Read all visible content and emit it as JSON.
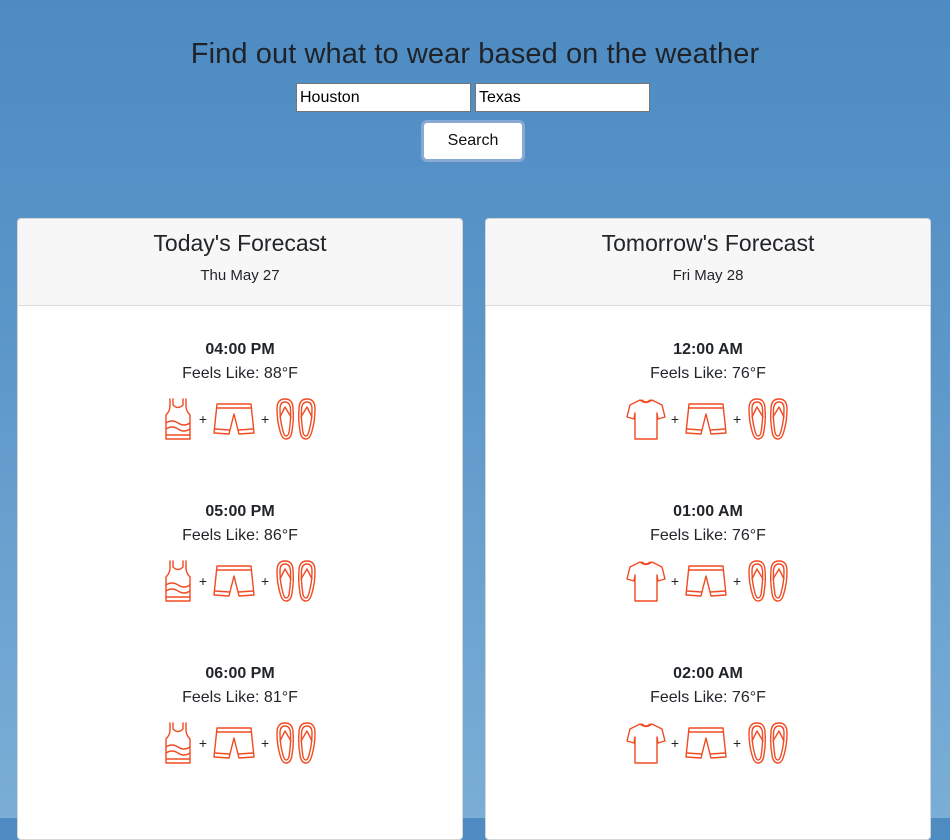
{
  "header": {
    "title": "Find out what to wear based on the weather",
    "city_value": "Houston",
    "state_value": "Texas",
    "search_label": "Search"
  },
  "colors": {
    "icon_stroke": "#f04b22",
    "background": "#5b96c9"
  },
  "today": {
    "title": "Today's Forecast",
    "date": "Thu May 27",
    "slots": [
      {
        "time": "04:00 PM",
        "feels": "Feels Like: 88°F",
        "plus1": "+",
        "plus2": "+",
        "icons": [
          "tank-top-icon",
          "shorts-icon",
          "flip-flops-icon"
        ]
      },
      {
        "time": "05:00 PM",
        "feels": "Feels Like: 86°F",
        "plus1": "+",
        "plus2": "+",
        "icons": [
          "tank-top-icon",
          "shorts-icon",
          "flip-flops-icon"
        ]
      },
      {
        "time": "06:00 PM",
        "feels": "Feels Like: 81°F",
        "plus1": "+",
        "plus2": "+",
        "icons": [
          "tank-top-icon",
          "shorts-icon",
          "flip-flops-icon"
        ]
      }
    ]
  },
  "tomorrow": {
    "title": "Tomorrow's Forecast",
    "date": "Fri May 28",
    "slots": [
      {
        "time": "12:00 AM",
        "feels": "Feels Like: 76°F",
        "plus1": "+",
        "plus2": "+",
        "icons": [
          "t-shirt-icon",
          "shorts-icon",
          "flip-flops-icon"
        ]
      },
      {
        "time": "01:00 AM",
        "feels": "Feels Like: 76°F",
        "plus1": "+",
        "plus2": "+",
        "icons": [
          "t-shirt-icon",
          "shorts-icon",
          "flip-flops-icon"
        ]
      },
      {
        "time": "02:00 AM",
        "feels": "Feels Like: 76°F",
        "plus1": "+",
        "plus2": "+",
        "icons": [
          "t-shirt-icon",
          "shorts-icon",
          "flip-flops-icon"
        ]
      }
    ]
  }
}
